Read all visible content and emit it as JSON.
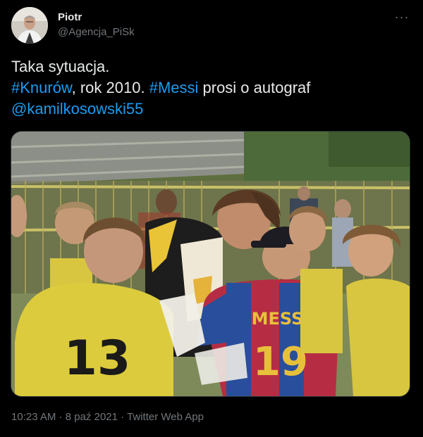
{
  "author": {
    "display_name": "Piotr",
    "handle": "@Agencja_PiSk",
    "avatar_icon": "avatar-photo"
  },
  "more_icon": "ellipsis-icon",
  "tweet": {
    "line1": "Taka sytuacja.",
    "hashtag1": "#Knurów",
    "text2": ", rok 2010. ",
    "hashtag2": "#Messi",
    "text3": " prosi o autograf",
    "mention": "@kamilkosowski55"
  },
  "photo": {
    "shirt_left_number": "13",
    "shirt_center_name": "MESSI",
    "shirt_center_number": "19"
  },
  "meta": {
    "time": "10:23 AM",
    "separator1": " · ",
    "date": "8 paź 2021",
    "separator2": " · ",
    "source": "Twitter Web App"
  },
  "colors": {
    "background": "#000000",
    "text": "#e7e9ea",
    "secondary": "#71767b",
    "link": "#1d9bf0"
  }
}
